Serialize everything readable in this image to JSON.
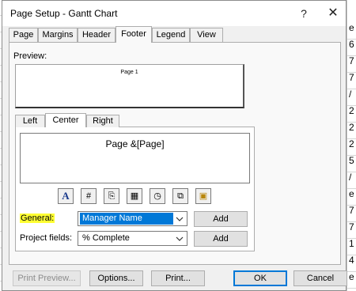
{
  "background": {
    "right_letters": [
      "e",
      "6",
      "7",
      "7",
      "/",
      "2",
      "2",
      "2",
      "5",
      "/",
      "e",
      "7",
      "7",
      "1",
      "4",
      "e"
    ]
  },
  "window": {
    "title": "Page Setup - Gantt Chart",
    "help_glyph": "?",
    "close_glyph": "✕"
  },
  "tabs": [
    "Page",
    "Margins",
    "Header",
    "Footer",
    "Legend",
    "View"
  ],
  "active_tab": "Footer",
  "preview": {
    "label": "Preview:",
    "page_text": "Page 1"
  },
  "alignment_tabs": [
    "Left",
    "Center",
    "Right"
  ],
  "active_alignment": "Center",
  "content": {
    "text": "Page &[Page]"
  },
  "toolbar_icons": [
    {
      "name": "format-text-font-icon",
      "glyph": "A"
    },
    {
      "name": "insert-page-number-icon",
      "glyph": "#"
    },
    {
      "name": "insert-total-pages-icon",
      "glyph": "⎘"
    },
    {
      "name": "insert-current-date-icon",
      "glyph": "▦"
    },
    {
      "name": "insert-current-time-icon",
      "glyph": "◷"
    },
    {
      "name": "insert-file-name-icon",
      "glyph": "⧉"
    },
    {
      "name": "insert-picture-icon",
      "glyph": "▣"
    }
  ],
  "general": {
    "label": "General:",
    "value": "Manager Name",
    "add_label": "Add"
  },
  "project_fields": {
    "label": "Project fields:",
    "value": "% Complete",
    "add_label": "Add"
  },
  "buttons": {
    "print_preview": "Print Preview...",
    "options": "Options...",
    "print": "Print...",
    "ok": "OK",
    "cancel": "Cancel"
  },
  "colors": {
    "selection": "#0078d7",
    "highlight": "#ffff33",
    "dialog_bg": "#f0f0f0"
  }
}
